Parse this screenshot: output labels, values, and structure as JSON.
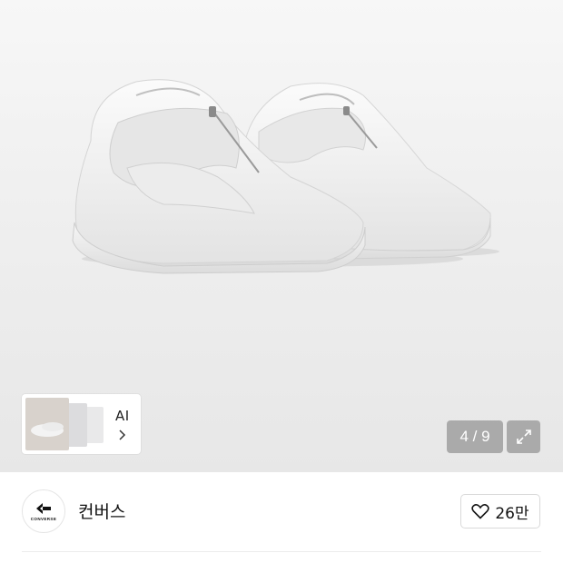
{
  "gallery": {
    "counter_text": "4 / 9",
    "thumb_label": "AI",
    "chevron_icon": "chevron-right-icon",
    "expand_icon": "expand-icon"
  },
  "brand": {
    "name": "컨버스",
    "logo_text": "CONVERSE",
    "logo_icon": "converse-logo-icon"
  },
  "like": {
    "icon": "heart-icon",
    "count": "26만"
  },
  "colors": {
    "overlay": "#969696",
    "text": "#111111",
    "border": "#d9d9d9"
  }
}
